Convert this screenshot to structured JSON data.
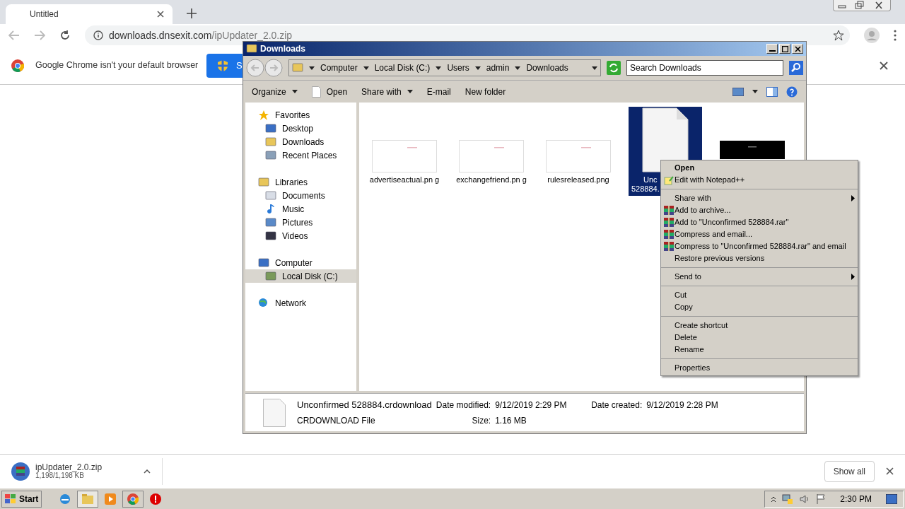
{
  "browser": {
    "tab": {
      "title": "Untitled",
      "selected": true
    },
    "address": {
      "domain": "downloads.dnsexit.com",
      "path": "/ipUpdater_2.0.zip"
    },
    "infobar": {
      "message": "Google Chrome isn't your default browser",
      "button": "S"
    },
    "download": {
      "name": "ipUpdater_2.0.zip",
      "progress": "1,198/1,198 KB"
    },
    "show_all": "Show all"
  },
  "explorer": {
    "title": "Downloads",
    "breadcrumb": [
      "Computer",
      "Local Disk (C:)",
      "Users",
      "admin",
      "Downloads"
    ],
    "search": {
      "placeholder": "Search Downloads"
    },
    "toolbar": [
      {
        "label": "Organize",
        "kind": "menu"
      },
      {
        "label": "Open",
        "kind": "open"
      },
      {
        "label": "Share with",
        "kind": "menu"
      },
      {
        "label": "E-mail",
        "kind": "plain"
      },
      {
        "label": "New folder",
        "kind": "plain"
      }
    ],
    "nav": [
      {
        "label": "Favorites",
        "selected": false,
        "children": [
          {
            "label": "Desktop",
            "selected": false
          },
          {
            "label": "Downloads",
            "selected": false
          },
          {
            "label": "Recent Places",
            "selected": false
          }
        ]
      },
      {
        "label": "Libraries",
        "selected": false,
        "children": [
          {
            "label": "Documents",
            "selected": false
          },
          {
            "label": "Music",
            "selected": false
          },
          {
            "label": "Pictures",
            "selected": false
          },
          {
            "label": "Videos",
            "selected": false
          }
        ]
      },
      {
        "label": "Computer",
        "selected": false,
        "children": [
          {
            "label": "Local Disk (C:)",
            "selected": true
          }
        ]
      },
      {
        "label": "Network",
        "selected": false
      }
    ],
    "files": [
      {
        "name": "advertiseactual.pn g",
        "kind": "light",
        "selected": false
      },
      {
        "name": "exchangefriend.pn g",
        "kind": "light",
        "selected": false
      },
      {
        "name": "rulesreleased.png",
        "kind": "light",
        "selected": false
      },
      {
        "name": "Unc 528884.",
        "kind": "document",
        "selected": true
      },
      {
        "kind": "dark",
        "selected": false
      }
    ],
    "details": {
      "name": "Unconfirmed 528884.crdownload",
      "type": "CRDOWNLOAD File",
      "modified_label": "Date modified:",
      "modified": "9/12/2019 2:29 PM",
      "created_label": "Date created:",
      "created": "9/12/2019 2:28 PM",
      "size_label": "Size:",
      "size": "1.16 MB"
    }
  },
  "context_menu": [
    [
      {
        "label": "Open",
        "kind": "default"
      },
      {
        "label": "Edit with Notepad++",
        "kind": "notepad"
      }
    ],
    [
      {
        "label": "Share with",
        "kind": "submenu"
      },
      {
        "label": "Add to archive...",
        "kind": "archive"
      },
      {
        "label": "Add to \"Unconfirmed 528884.rar\"",
        "kind": "archive"
      },
      {
        "label": "Compress and email...",
        "kind": "archive"
      },
      {
        "label": "Compress to \"Unconfirmed 528884.rar\" and email",
        "kind": "archive"
      },
      {
        "label": "Restore previous versions",
        "kind": "plain"
      }
    ],
    [
      {
        "label": "Send to",
        "kind": "submenu"
      }
    ],
    [
      {
        "label": "Cut",
        "kind": "plain"
      },
      {
        "label": "Copy",
        "kind": "plain"
      }
    ],
    [
      {
        "label": "Create shortcut",
        "kind": "plain"
      },
      {
        "label": "Delete",
        "kind": "plain"
      },
      {
        "label": "Rename",
        "kind": "plain"
      }
    ],
    [
      {
        "label": "Properties",
        "kind": "plain"
      }
    ]
  ],
  "taskbar": {
    "start": "Start",
    "clock": "2:30 PM"
  }
}
